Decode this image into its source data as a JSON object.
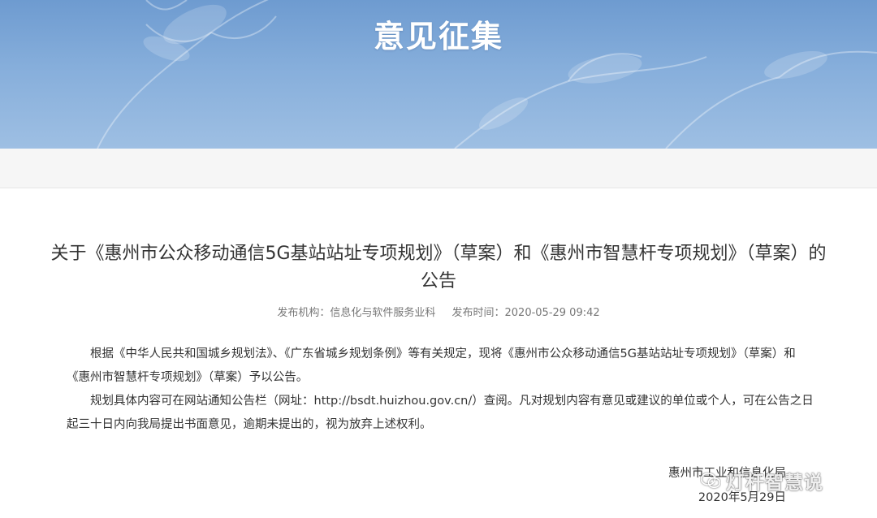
{
  "banner": {
    "title": "意见征集"
  },
  "article": {
    "title": "关于《惠州市公众移动通信5G基站站址专项规划》（草案）和《惠州市智慧杆专项规划》（草案）的公告",
    "meta": {
      "publisher": "发布机构：信息化与软件服务业科",
      "time": "发布时间：2020-05-29 09:42"
    },
    "paragraphs": [
      "根据《中华人民共和国城乡规划法》、《广东省城乡规划条例》等有关规定，现将《惠州市公众移动通信5G基站站址专项规划》（草案）和《惠州市智慧杆专项规划》（草案）予以公告。",
      "规划具体内容可在网站通知公告栏（网址：http://bsdt.huizhou.gov.cn/）查阅。凡对规划内容有意见或建议的单位或个人，可在公告之日起三十日内向我局提出书面意见，逾期未提出的，视为放弃上述权利。"
    ],
    "signature": {
      "org": "惠州市工业和信息化局",
      "date": "2020年5月29日"
    }
  },
  "watermark": {
    "text": "灯杆智慧说",
    "icon": "wechat-icon"
  }
}
